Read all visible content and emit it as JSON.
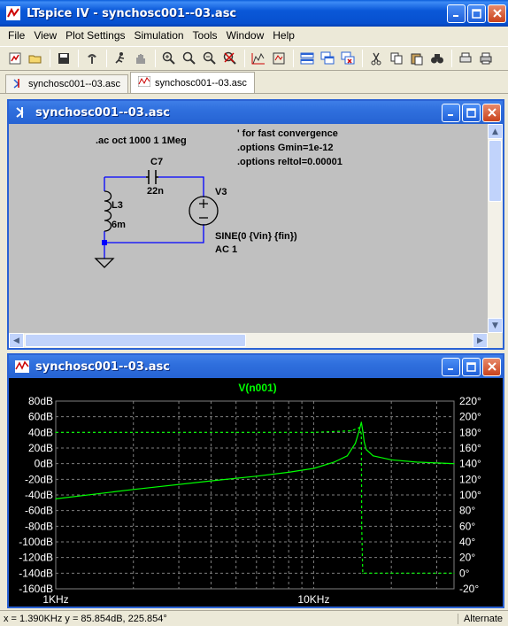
{
  "app": {
    "title": "LTspice IV - synchosc001--03.asc"
  },
  "menu": [
    "File",
    "View",
    "Plot Settings",
    "Simulation",
    "Tools",
    "Window",
    "Help"
  ],
  "toolbar": {
    "icons": [
      "new-schematic-icon",
      "open-icon",
      "save-icon",
      "control-panel-icon",
      "run-icon",
      "halt-icon",
      "zoom-in-icon",
      "zoom-fit-icon",
      "zoom-out-icon",
      "zoom-cancel-icon",
      "autorange-icon",
      "mark-icon",
      "tile-horizontal-icon",
      "cascade-icon",
      "close-all-icon",
      "cut-icon",
      "copy-icon",
      "paste-icon",
      "find-icon",
      "print-setup-icon",
      "print-icon"
    ]
  },
  "tabs": [
    {
      "label": "synchosc001--03.asc",
      "icon": "schematic-icon"
    },
    {
      "label": "synchosc001--03.asc",
      "icon": "waveform-icon"
    }
  ],
  "schematic_window": {
    "title": "synchosc001--03.asc",
    "directive_ac": ".ac oct 1000 1 1Meg",
    "comment": "' for fast convergence",
    "option1": ".options Gmin=1e-12",
    "option2": ".options reltol=0.00001",
    "c_name": "C7",
    "c_value": "22n",
    "l_name": "L3",
    "l_value": "6m",
    "v_name": "V3",
    "v_value1": "SINE(0 {Vin} {fin})",
    "v_value2": "AC 1"
  },
  "plot_window": {
    "title": "synchosc001--03.asc"
  },
  "status": {
    "cursor": "x = 1.390KHz    y = 85.854dB, 225.854°",
    "mode": "Alternate"
  },
  "colors": {
    "trace": "#00ff00",
    "grid": "#808080",
    "schem_wire": "#0000ff",
    "title_blue": "#0750cf"
  },
  "chart_data": {
    "type": "line",
    "title": "V(n001)",
    "xscale": "log",
    "xlim": [
      1000,
      35000
    ],
    "xticks": [
      "1KHz",
      "10KHz"
    ],
    "ylim_left": [
      -160,
      80
    ],
    "yticks_left": [
      "80dB",
      "60dB",
      "40dB",
      "20dB",
      "0dB",
      "-20dB",
      "-40dB",
      "-60dB",
      "-80dB",
      "-100dB",
      "-120dB",
      "-140dB",
      "-160dB"
    ],
    "ylim_right": [
      -20,
      220
    ],
    "yticks_right": [
      "220°",
      "200°",
      "180°",
      "160°",
      "140°",
      "120°",
      "100°",
      "80°",
      "60°",
      "40°",
      "20°",
      "0°",
      "-20°"
    ],
    "grid": true,
    "series": [
      {
        "name": "magnitude",
        "unit": "dB",
        "style": "solid",
        "x": [
          1000,
          2000,
          4000,
          6000,
          8000,
          10000,
          12000,
          13500,
          14500,
          15000,
          15300,
          15500,
          15700,
          16000,
          17000,
          20000,
          25000,
          35000
        ],
        "y": [
          -45,
          -33,
          -22,
          -16,
          -11,
          -6,
          2,
          10,
          26,
          42,
          53,
          42,
          28,
          18,
          10,
          5,
          2,
          0
        ]
      },
      {
        "name": "phase",
        "unit": "°",
        "style": "dashed",
        "x": [
          1000,
          5000,
          10000,
          14000,
          15000,
          15300,
          15350,
          15500,
          20000,
          35000
        ],
        "y": [
          180,
          180,
          180,
          182,
          186,
          178,
          60,
          0,
          0,
          0
        ]
      }
    ]
  }
}
